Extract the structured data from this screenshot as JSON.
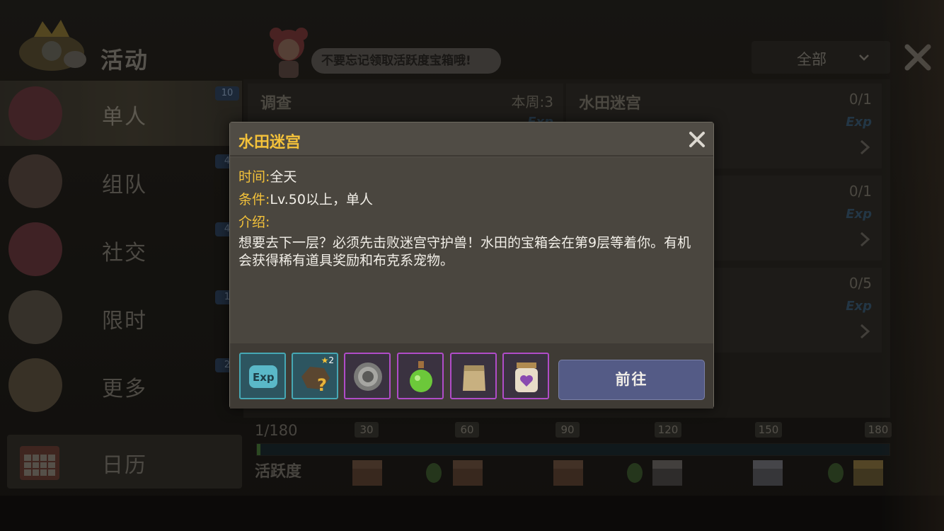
{
  "header": {
    "title": "活动",
    "tip": "不要忘记领取活跃度宝箱哦!",
    "filter_label": "全部"
  },
  "sidebar": {
    "items": [
      {
        "label": "单人",
        "badge": "10"
      },
      {
        "label": "组队",
        "badge": "4"
      },
      {
        "label": "社交",
        "badge": "4"
      },
      {
        "label": "限时",
        "badge": "1"
      },
      {
        "label": "更多",
        "badge": "2"
      }
    ],
    "calendar_label": "日历"
  },
  "activities": [
    {
      "name": "调查",
      "count": "本周:3",
      "exp": "Exp"
    },
    {
      "name": "水田迷宫",
      "count": "0/1",
      "exp": "Exp"
    },
    {
      "name": "",
      "count": "0/1",
      "exp": "Exp"
    },
    {
      "name": "",
      "count": "0/5",
      "exp": "Exp"
    }
  ],
  "activeness": {
    "current": "1/180",
    "label": "活跃度",
    "milestones": [
      "30",
      "60",
      "90",
      "120",
      "150",
      "180"
    ],
    "progress": 1,
    "max": 180
  },
  "modal": {
    "title": "水田迷宫",
    "time_key": "时间:",
    "time_value": "全天",
    "cond_key": "条件:",
    "cond_value": "Lv.50以上，单人",
    "intro_key": "介绍:",
    "description": "想要去下一层？必须先击败迷宫守护兽！水田的宝箱会在第9层等着你。有机会获得稀有道具奖励和布克系宠物。",
    "rewards": [
      {
        "icon": "exp-icon",
        "rarity": "teal"
      },
      {
        "icon": "mystery-pet-icon",
        "rarity": "teal",
        "stars": "2"
      },
      {
        "icon": "beast-coin-icon",
        "rarity": "purple"
      },
      {
        "icon": "green-potion-icon",
        "rarity": "purple"
      },
      {
        "icon": "paper-bag-icon",
        "rarity": "purple"
      },
      {
        "icon": "heart-jar-icon",
        "rarity": "purple"
      }
    ],
    "goto_label": "前往"
  },
  "colors": {
    "accent": "#f4c23a",
    "button": "#545b86",
    "teal_frame": "#46a8b4",
    "purple_frame": "#b04cc8"
  }
}
